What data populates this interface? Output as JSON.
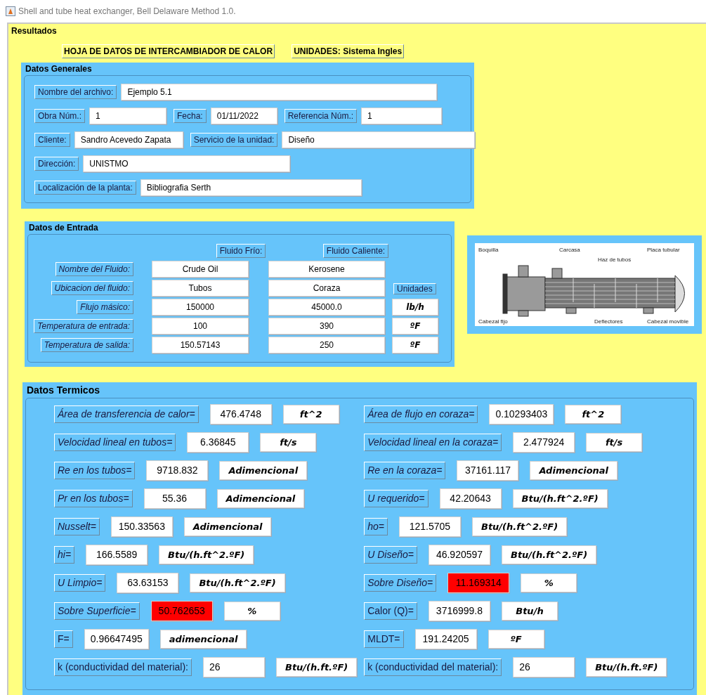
{
  "window": {
    "title": "Shell and tube heat exchanger, Bell Delaware Method 1.0."
  },
  "panel": {
    "title": "Resultados"
  },
  "headings": [
    "HOJA DE DATOS DE INTERCAMBIADOR DE CALOR",
    "UNIDADES: Sistema Ingles"
  ],
  "general": {
    "title": "Datos Generales",
    "rows": [
      [
        {
          "label": "Nombre del archivo:",
          "value": "Ejemplo 5.1"
        }
      ],
      [
        {
          "label": "Obra Núm.:",
          "value": "1"
        },
        {
          "label": "Fecha:",
          "value": "01/11/2022"
        },
        {
          "label": "Referencia Núm.:",
          "value": "1"
        }
      ],
      [
        {
          "label": "Cliente:",
          "value": "Sandro Acevedo Zapata"
        },
        {
          "label": "Servicio de la unidad:",
          "value": "Diseño"
        }
      ],
      [
        {
          "label": "Dirección:",
          "value": "UNISTMO"
        }
      ],
      [
        {
          "label": "Localización de la planta:",
          "value": "Bibliografia Serth"
        }
      ]
    ]
  },
  "input": {
    "title": "Datos de Entrada",
    "cold_header": "Fluido Frío:",
    "hot_header": "Fluido  Caliente:",
    "rows": [
      {
        "label": "Nombre del Fluido:",
        "cold": "Crude Oil",
        "hot": "Kerosene"
      },
      {
        "label": "Ubicacion del fluido:",
        "cold": "Tubos",
        "hot": "Coraza",
        "unit": {
          "kind": "header",
          "text": "Unidades"
        }
      },
      {
        "label": "Flujo másico:",
        "cold": "150000",
        "hot": "45000.0",
        "unit": {
          "kind": "field",
          "text": "lb/h"
        }
      },
      {
        "label": "Temperatura de entrada:",
        "cold": "100",
        "hot": "390",
        "unit": {
          "kind": "field",
          "text": "ºF"
        }
      },
      {
        "label": "Temperatura de salida:",
        "cold": "150.57143",
        "hot": "250",
        "unit": {
          "kind": "field",
          "text": "ºF"
        }
      }
    ]
  },
  "diagram": {
    "labels": [
      "Boquilla",
      "Carcasa",
      "Haz de tubos",
      "Placa tubular",
      "Cabezal fijo",
      "Deflectores",
      "Cabezal movible"
    ]
  },
  "thermal": {
    "title": "Datos Termicos",
    "left": [
      {
        "label": "Área de transferencia de calor=",
        "value": "476.4748",
        "unit": "ft^2",
        "italic": true,
        "alert": false
      },
      {
        "label": "Velocidad lineal en tubos=",
        "value": "6.36845",
        "unit": "ft/s",
        "italic": true,
        "alert": false
      },
      {
        "label": "Re en los tubos=",
        "value": "9718.832",
        "unit": "Adimencional",
        "italic": true,
        "alert": false
      },
      {
        "label": "Pr en los tubos=",
        "value": "55.36",
        "unit": "Adimencional",
        "italic": true,
        "alert": false
      },
      {
        "label": "Nusselt=",
        "value": "150.33563",
        "unit": "Adimencional",
        "italic": true,
        "alert": false
      },
      {
        "label": "hi=",
        "value": "166.5589",
        "unit": "Btu/(h.ft^2.ºF)",
        "italic": true,
        "alert": false
      },
      {
        "label": "U Limpio=",
        "value": "63.63153",
        "unit": "Btu/(h.ft^2.ºF)",
        "italic": true,
        "alert": false
      },
      {
        "label": "Sobre Superficie=",
        "value": "50.762653",
        "unit": "%",
        "italic": true,
        "alert": true
      },
      {
        "label": "F=",
        "value": "0.96647495",
        "unit": "adimencional",
        "italic": false,
        "alert": false
      },
      {
        "label": "k (conductividad del material):",
        "value": "26",
        "unit": "Btu/(h.ft.ºF)",
        "italic": false,
        "alert": false
      }
    ],
    "right": [
      {
        "label": "Área de flujo en coraza=",
        "value": "0.10293403",
        "unit": "ft^2",
        "italic": true,
        "alert": false
      },
      {
        "label": "Velocidad lineal en la coraza=",
        "value": "2.477924",
        "unit": "ft/s",
        "italic": true,
        "alert": false
      },
      {
        "label": "Re en la coraza=",
        "value": "37161.117",
        "unit": "Adimencional",
        "italic": true,
        "alert": false
      },
      {
        "label": "U requerido=",
        "value": "42.20643",
        "unit": "Btu/(h.ft^2.ºF)",
        "italic": true,
        "alert": false
      },
      {
        "label": "ho=",
        "value": "121.5705",
        "unit": "Btu/(h.ft^2.ºF)",
        "italic": true,
        "alert": false
      },
      {
        "label": "U Diseño=",
        "value": "46.920597",
        "unit": "Btu/(h.ft^2.ºF)",
        "italic": true,
        "alert": false
      },
      {
        "label": "Sobre Diseño=",
        "value": "11.169314",
        "unit": "%",
        "italic": true,
        "alert": true
      },
      {
        "label": "Calor (Q)=",
        "value": "3716999.8",
        "unit": "Btu/h",
        "italic": false,
        "alert": false
      },
      {
        "label": "MLDT=",
        "value": "191.24205",
        "unit": "ºF",
        "italic": false,
        "alert": false
      },
      {
        "label": "k (conductividad del material):",
        "value": "26",
        "unit": "Btu/(h.ft.ºF)",
        "italic": false,
        "alert": false
      }
    ]
  }
}
